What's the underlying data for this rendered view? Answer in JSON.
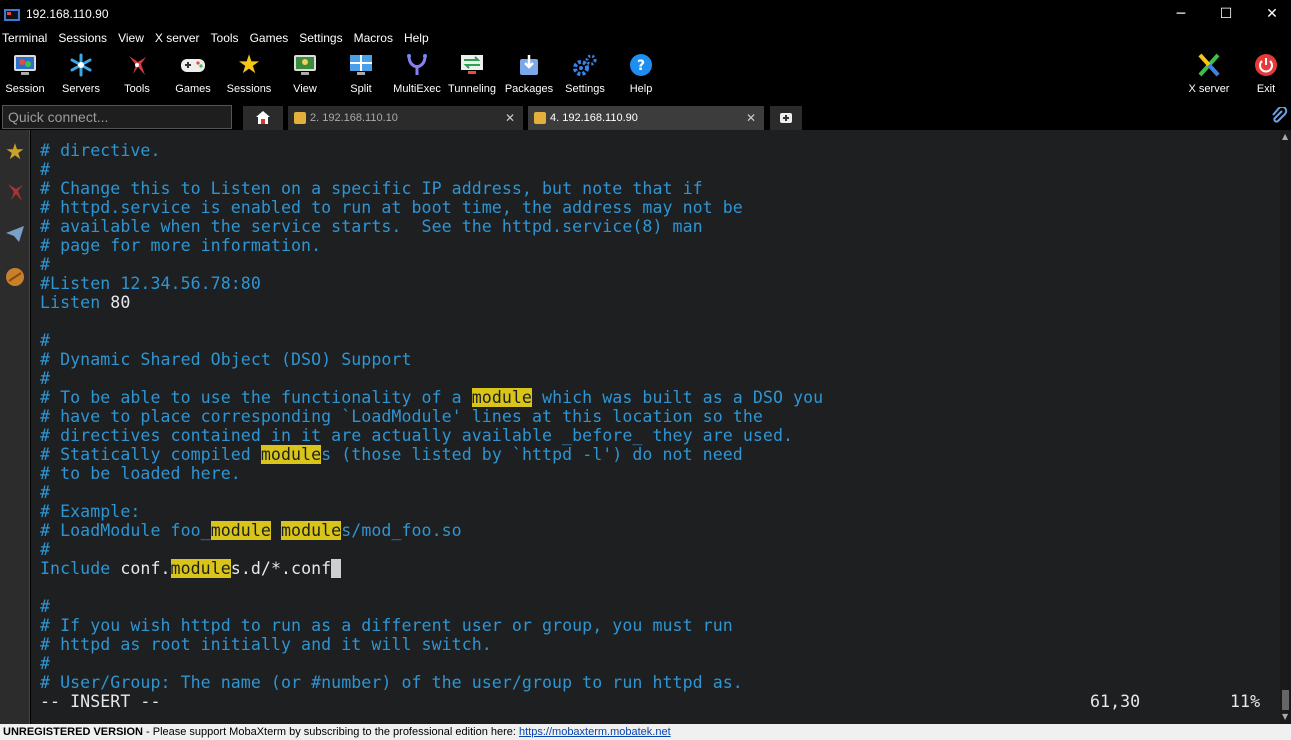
{
  "window": {
    "title": "192.168.110.90",
    "controls": {
      "minimize": "─",
      "maximize": "☐",
      "close": "✕"
    }
  },
  "menu": [
    "Terminal",
    "Sessions",
    "View",
    "X server",
    "Tools",
    "Games",
    "Settings",
    "Macros",
    "Help"
  ],
  "toolbar": {
    "items": [
      {
        "label": "Session",
        "icon": "session-icon"
      },
      {
        "label": "Servers",
        "icon": "servers-icon"
      },
      {
        "label": "Tools",
        "icon": "tools-icon"
      },
      {
        "label": "Games",
        "icon": "games-icon"
      },
      {
        "label": "Sessions",
        "icon": "star-icon"
      },
      {
        "label": "View",
        "icon": "view-icon"
      },
      {
        "label": "Split",
        "icon": "split-icon"
      },
      {
        "label": "MultiExec",
        "icon": "multiexec-icon"
      },
      {
        "label": "Tunneling",
        "icon": "tunneling-icon"
      },
      {
        "label": "Packages",
        "icon": "packages-icon"
      },
      {
        "label": "Settings",
        "icon": "settings-icon"
      },
      {
        "label": "Help",
        "icon": "help-icon"
      }
    ],
    "xserver_label": "X server",
    "exit_label": "Exit"
  },
  "quick_connect": {
    "placeholder": "Quick connect..."
  },
  "tabs": [
    {
      "label": "2. 192.168.110.10",
      "close": "✕"
    },
    {
      "label": "4. 192.168.110.90",
      "close": "✕"
    }
  ],
  "terminal": {
    "lines": [
      "# directive.",
      "#",
      "# Change this to Listen on a specific IP address, but note that if",
      "# httpd.service is enabled to run at boot time, the address may not be",
      "# available when the service starts.  See the httpd.service(8) man",
      "# page for more information.",
      "#",
      "#Listen 12.34.56.78:80",
      "Listen 80",
      "",
      "#",
      "# Dynamic Shared Object (DSO) Support",
      "#",
      "# To be able to use the functionality of a module which was built as a DSO you",
      "# have to place corresponding `LoadModule' lines at this location so the",
      "# directives contained in it are actually available _before_ they are used.",
      "# Statically compiled modules (those listed by `httpd -l') do not need",
      "# to be loaded here.",
      "#",
      "# Example:",
      "# LoadModule foo_module modules/mod_foo.so",
      "#",
      "Include conf.modules.d/*.conf",
      "",
      "#",
      "# If you wish httpd to run as a different user or group, you must run",
      "# httpd as root initially and it will switch.",
      "#",
      "# User/Group: The name (or #number) of the user/group to run httpd as."
    ],
    "search_term": "module",
    "mode": "-- INSERT --",
    "position": "61,30",
    "percent": "11%"
  },
  "statusbar": {
    "unregistered": "UNREGISTERED VERSION",
    "message": " -  Please support MobaXterm by subscribing to the professional edition here:  ",
    "link": "https://mobaxterm.mobatek.net"
  },
  "colors": {
    "comment": "#2e95d3",
    "text": "#e8e8e8",
    "highlight": "#d9c41a",
    "background": "#1d1f21"
  }
}
